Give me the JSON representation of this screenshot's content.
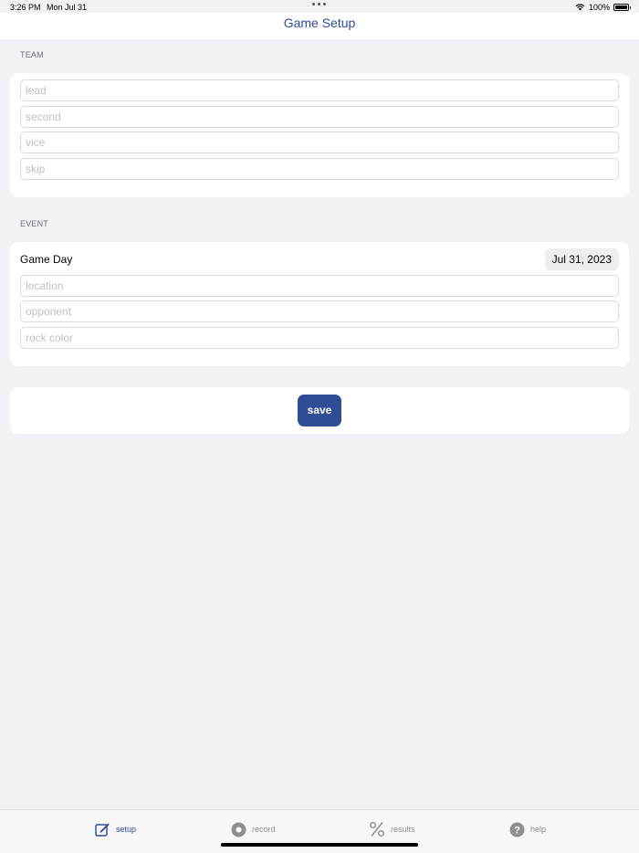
{
  "status": {
    "time": "3:26 PM",
    "date": "Mon Jul 31",
    "battery": "100%"
  },
  "nav": {
    "title": "Game Setup"
  },
  "team": {
    "header": "TEAM",
    "fields": [
      {
        "placeholder": "lead",
        "value": ""
      },
      {
        "placeholder": "second",
        "value": ""
      },
      {
        "placeholder": "vice",
        "value": ""
      },
      {
        "placeholder": "skip",
        "value": ""
      }
    ]
  },
  "event": {
    "header": "EVENT",
    "game_day_label": "Game Day",
    "game_day_value": "Jul 31, 2023",
    "fields": [
      {
        "placeholder": "location",
        "value": ""
      },
      {
        "placeholder": "opponent",
        "value": ""
      },
      {
        "placeholder": "rock color",
        "value": ""
      }
    ]
  },
  "actions": {
    "save_label": "save"
  },
  "tabs": [
    {
      "label": "setup",
      "icon": "edit-square-icon",
      "active": true
    },
    {
      "label": "record",
      "icon": "record-icon",
      "active": false
    },
    {
      "label": "results",
      "icon": "percent-icon",
      "active": false
    },
    {
      "label": "help",
      "icon": "help-icon",
      "active": false
    }
  ],
  "colors": {
    "accent": "#2f4c95",
    "background": "#f2f1f6",
    "inactive_tab": "#8e8e93"
  }
}
